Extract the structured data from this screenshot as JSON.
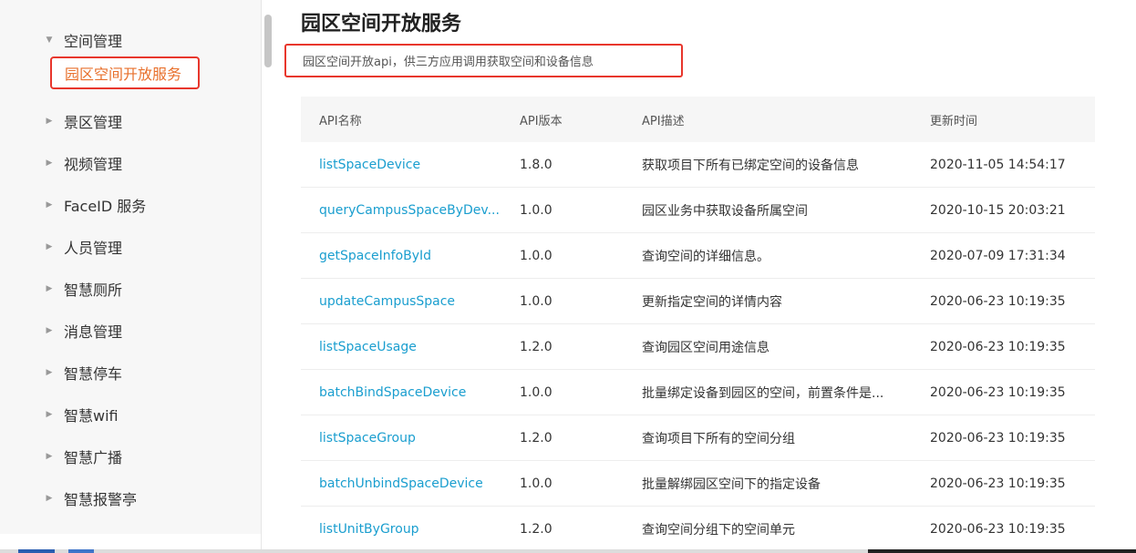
{
  "sidebar": {
    "items": [
      {
        "label": "空间管理",
        "expanded": true
      },
      {
        "label": "园区空间开放服务",
        "active": true
      },
      {
        "label": "景区管理"
      },
      {
        "label": "视频管理"
      },
      {
        "label": "FaceID 服务"
      },
      {
        "label": "人员管理"
      },
      {
        "label": "智慧厕所"
      },
      {
        "label": "消息管理"
      },
      {
        "label": "智慧停车"
      },
      {
        "label": "智慧wifi"
      },
      {
        "label": "智慧广播"
      },
      {
        "label": "智慧报警亭"
      }
    ]
  },
  "main": {
    "title": "园区空间开放服务",
    "description": "园区空间开放api，供三方应用调用获取空间和设备信息"
  },
  "table": {
    "headers": [
      "API名称",
      "API版本",
      "API描述",
      "更新时间"
    ],
    "rows": [
      [
        "listSpaceDevice",
        "1.8.0",
        "获取项目下所有已绑定空间的设备信息",
        "2020-11-05 14:54:17"
      ],
      [
        "queryCampusSpaceByDev...",
        "1.0.0",
        "园区业务中获取设备所属空间",
        "2020-10-15 20:03:21"
      ],
      [
        "getSpaceInfoById",
        "1.0.0",
        "查询空间的详细信息。",
        "2020-07-09 17:31:34"
      ],
      [
        "updateCampusSpace",
        "1.0.0",
        "更新指定空间的详情内容",
        "2020-06-23 10:19:35"
      ],
      [
        "listSpaceUsage",
        "1.2.0",
        "查询园区空间用途信息",
        "2020-06-23 10:19:35"
      ],
      [
        "batchBindSpaceDevice",
        "1.0.0",
        "批量绑定设备到园区的空间，前置条件是...",
        "2020-06-23 10:19:35"
      ],
      [
        "listSpaceGroup",
        "1.2.0",
        "查询项目下所有的空间分组",
        "2020-06-23 10:19:35"
      ],
      [
        "batchUnbindSpaceDevice",
        "1.0.0",
        "批量解绑园区空间下的指定设备",
        "2020-06-23 10:19:35"
      ],
      [
        "listUnitByGroup",
        "1.2.0",
        "查询空间分组下的空间单元",
        "2020-06-23 10:19:35"
      ]
    ]
  },
  "colors": {
    "highlight_border": "#e8362c",
    "active_text": "#e8702c",
    "link": "#1a9ecf"
  },
  "icons": {
    "expanded": "caret-down-icon",
    "collapsed": "caret-right-icon"
  }
}
